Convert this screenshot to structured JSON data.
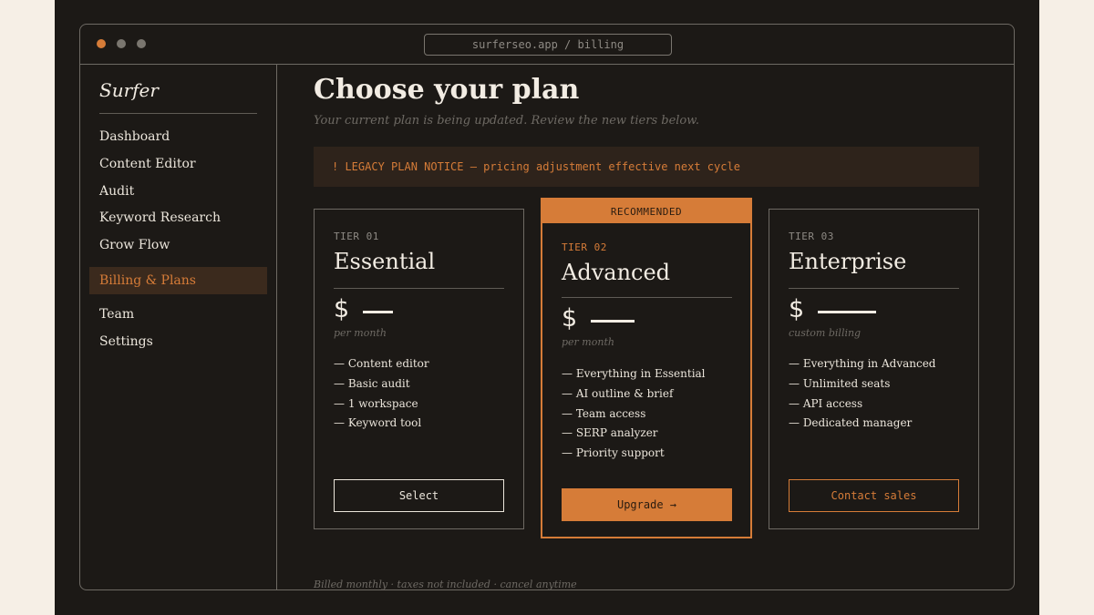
{
  "window": {
    "url": "surferseo.app / billing"
  },
  "sidebar": {
    "brand": "Surfer",
    "items": [
      {
        "label": "Dashboard"
      },
      {
        "label": "Content Editor"
      },
      {
        "label": "Audit"
      },
      {
        "label": "Keyword Research"
      },
      {
        "label": "Grow Flow"
      },
      {
        "label": "Billing & Plans",
        "active": true
      },
      {
        "label": "Team"
      },
      {
        "label": "Settings"
      }
    ]
  },
  "main": {
    "title": "Choose your plan",
    "subtitle": "Your current plan is being updated. Review the new tiers below.",
    "notice": "! LEGACY PLAN NOTICE — pricing adjustment effective next cycle",
    "footer": "Billed monthly · taxes not included · cancel anytime"
  },
  "plans": [
    {
      "tier": "TIER 01",
      "name": "Essential",
      "currency": "$",
      "price": "—",
      "period": "per month",
      "features": [
        "— Content editor",
        "— Basic audit",
        "— 1 workspace",
        "— Keyword tool"
      ],
      "button": "Select"
    },
    {
      "badge": "RECOMMENDED",
      "tier": "TIER 02",
      "name": "Advanced",
      "currency": "$",
      "price": "—",
      "period": "per month",
      "features": [
        "— Everything in Essential",
        "— AI outline & brief",
        "— Team access",
        "— SERP analyzer",
        "— Priority support"
      ],
      "button": "Upgrade →"
    },
    {
      "tier": "TIER 03",
      "name": "Enterprise",
      "currency": "$",
      "price": "—",
      "period": "custom billing",
      "features": [
        "— Everything in Advanced",
        "— Unlimited seats",
        "— API access",
        "— Dedicated manager"
      ],
      "button": "Contact sales"
    }
  ],
  "colors": {
    "accent": "#d67c38",
    "background": "#1c1916",
    "outer_background": "#f6efe6",
    "text": "#f2ece3",
    "muted": "#6e6a64"
  }
}
